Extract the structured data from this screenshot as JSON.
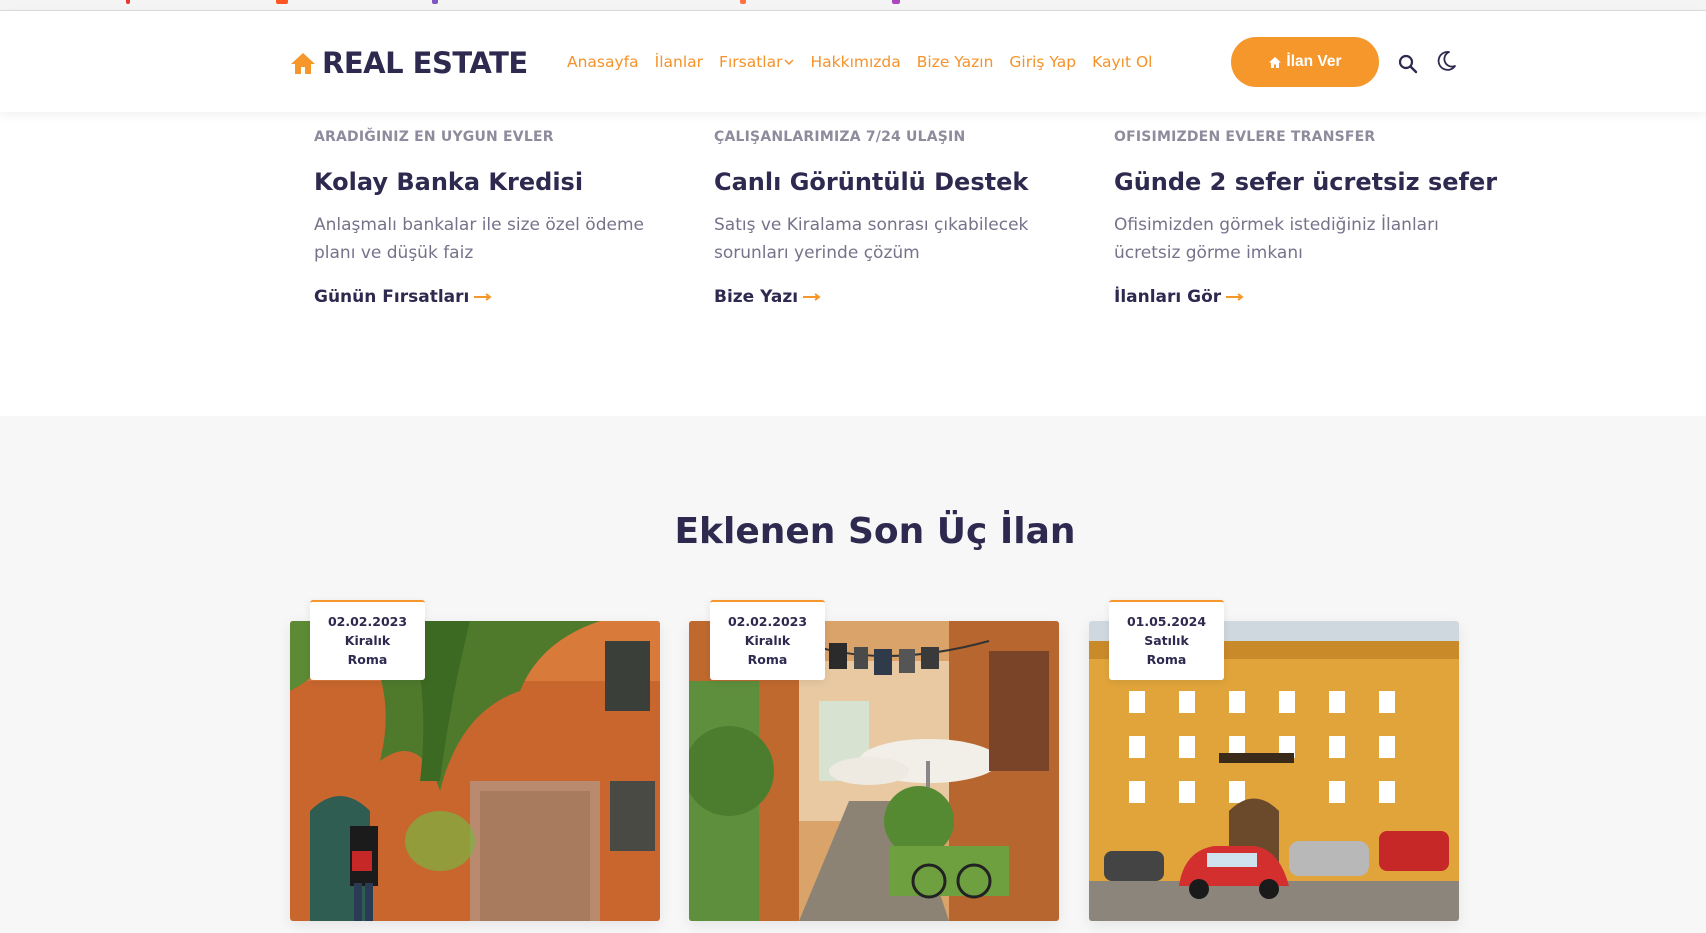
{
  "brand": {
    "name": "REAL ESTATE",
    "accent": "#f6972c",
    "dark": "#2e2a4f"
  },
  "nav": {
    "items": [
      "Anasayfa",
      "İlanlar",
      "Fırsatlar",
      "Hakkımızda",
      "Bize Yazın",
      "Giriş Yap",
      "Kayıt Ol"
    ],
    "post_button": "İlan Ver"
  },
  "features": [
    {
      "kicker": "ARADIĞINIZ EN UYGUN EVLER",
      "title": "Kolay Banka Kredisi",
      "desc": "Anlaşmalı bankalar ile size özel ödeme planı ve düşük faiz",
      "link": "Günün Fırsatları"
    },
    {
      "kicker": "ÇALIŞANLARIMIZA 7/24 ULAŞIN",
      "title": "Canlı Görüntülü Destek",
      "desc": "Satış ve Kiralama sonrası çıkabilecek sorunları yerinde çözüm",
      "link": "Bize Yazı"
    },
    {
      "kicker": "OFISIMIZDEN EVLERE TRANSFER",
      "title": "Günde 2 sefer ücretsiz sefer",
      "desc": "Ofisimizden görmek istediğiniz İlanları ücretsiz görme imkanı",
      "link": "İlanları Gör"
    }
  ],
  "listings": {
    "title": "Eklenen Son Üç İlan",
    "cards": [
      {
        "date": "02.02.2023",
        "type": "Kiralık",
        "city": "Roma"
      },
      {
        "date": "02.02.2023",
        "type": "Kiralık",
        "city": "Roma"
      },
      {
        "date": "01.05.2024",
        "type": "Satılık",
        "city": "Roma"
      }
    ]
  }
}
